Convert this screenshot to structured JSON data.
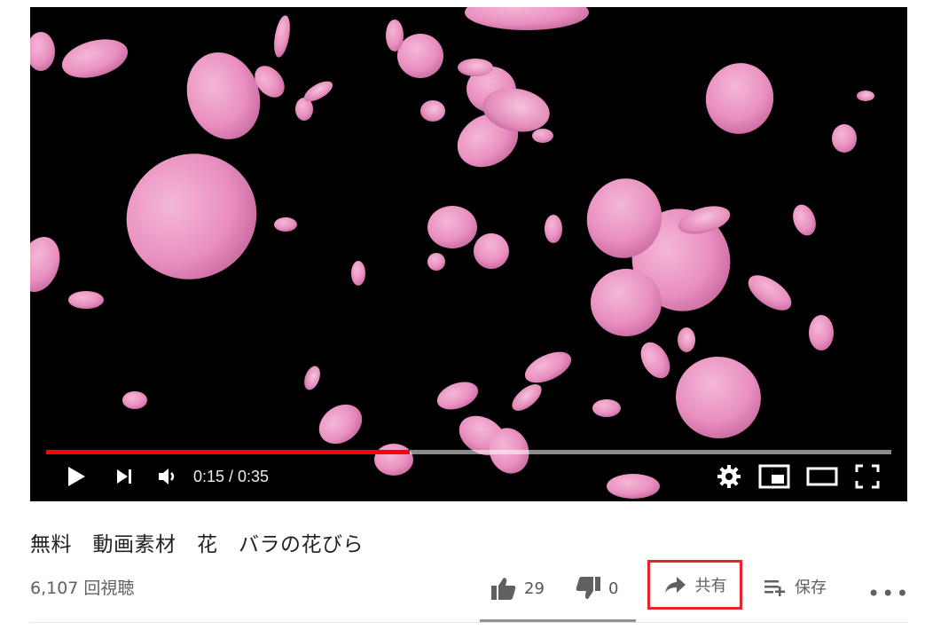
{
  "player": {
    "time_display": "0:15 / 0:35",
    "progress": 0.43,
    "progress_color": "#ff0000",
    "icons": [
      "play-icon",
      "next-icon",
      "volume-icon",
      "settings-icon",
      "miniplayer-icon",
      "theater-icon",
      "fullscreen-icon"
    ]
  },
  "video": {
    "title": "無料　動画素材　花　バラの花びら",
    "views": "6,107 回視聴"
  },
  "actions": {
    "like_count": "29",
    "dislike_count": "0",
    "share_label": "共有",
    "save_label": "保存",
    "more_label": "•••"
  },
  "highlight_color": "#e8232b"
}
